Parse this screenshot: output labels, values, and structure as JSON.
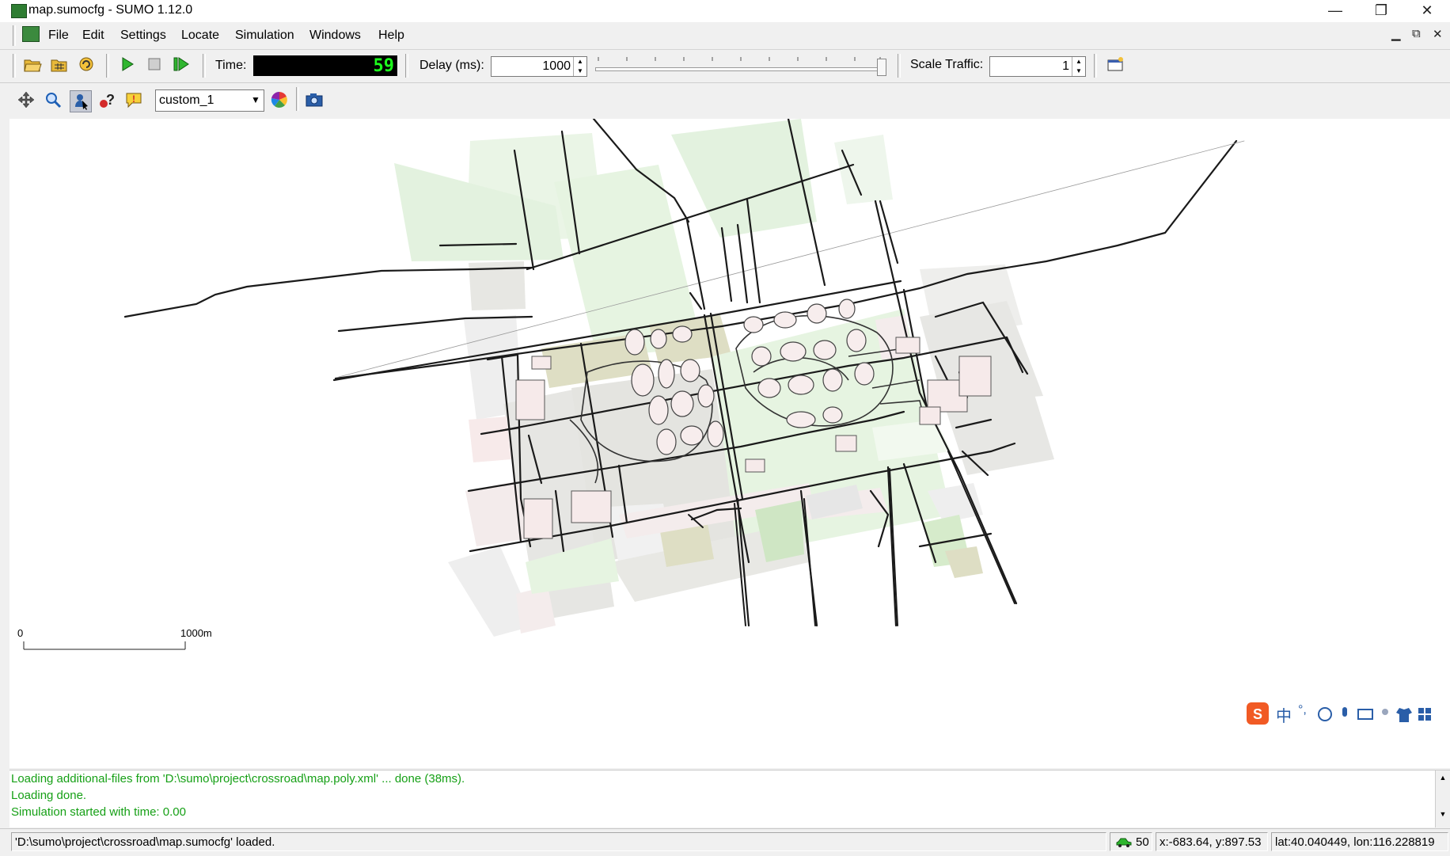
{
  "window": {
    "title": "map.sumocfg - SUMO 1.12.0",
    "minimize": "—",
    "restore": "❐",
    "close": "✕"
  },
  "menu": {
    "items": [
      "File",
      "Edit",
      "Settings",
      "Locate",
      "Simulation",
      "Windows",
      "Help"
    ],
    "mdi_minimize": "▁",
    "mdi_restore": "⧉",
    "mdi_close": "✕"
  },
  "toolbar": {
    "time_label": "Time:",
    "time_value": "59",
    "delay_label": "Delay (ms):",
    "delay_value": "1000",
    "scale_label": "Scale Traffic:",
    "scale_value": "1",
    "delay_slider_fraction": 1.0
  },
  "view_toolbar": {
    "scheme": "custom_1"
  },
  "map": {
    "scale_start": "0",
    "scale_end": "1000m"
  },
  "messages": [
    "Loading additional-files from 'D:\\sumo\\project\\crossroad\\map.poly.xml' ... done (38ms).",
    "Loading done.",
    "Simulation started with time: 0.00"
  ],
  "status": {
    "message": "'D:\\sumo\\project\\crossroad\\map.sumocfg' loaded.",
    "vehicles": "50",
    "xy": "x:-683.64, y:897.53",
    "latlon": "lat:40.040449, lon:116.228819"
  },
  "ime": {
    "zh": "中",
    "punct": "°,"
  },
  "colors": {
    "message_green": "#16a016",
    "time_green": "#1cff1c",
    "park_green": "#e6f4e1",
    "building_gray": "#e4e4e0",
    "road": "#1a1a1a"
  }
}
